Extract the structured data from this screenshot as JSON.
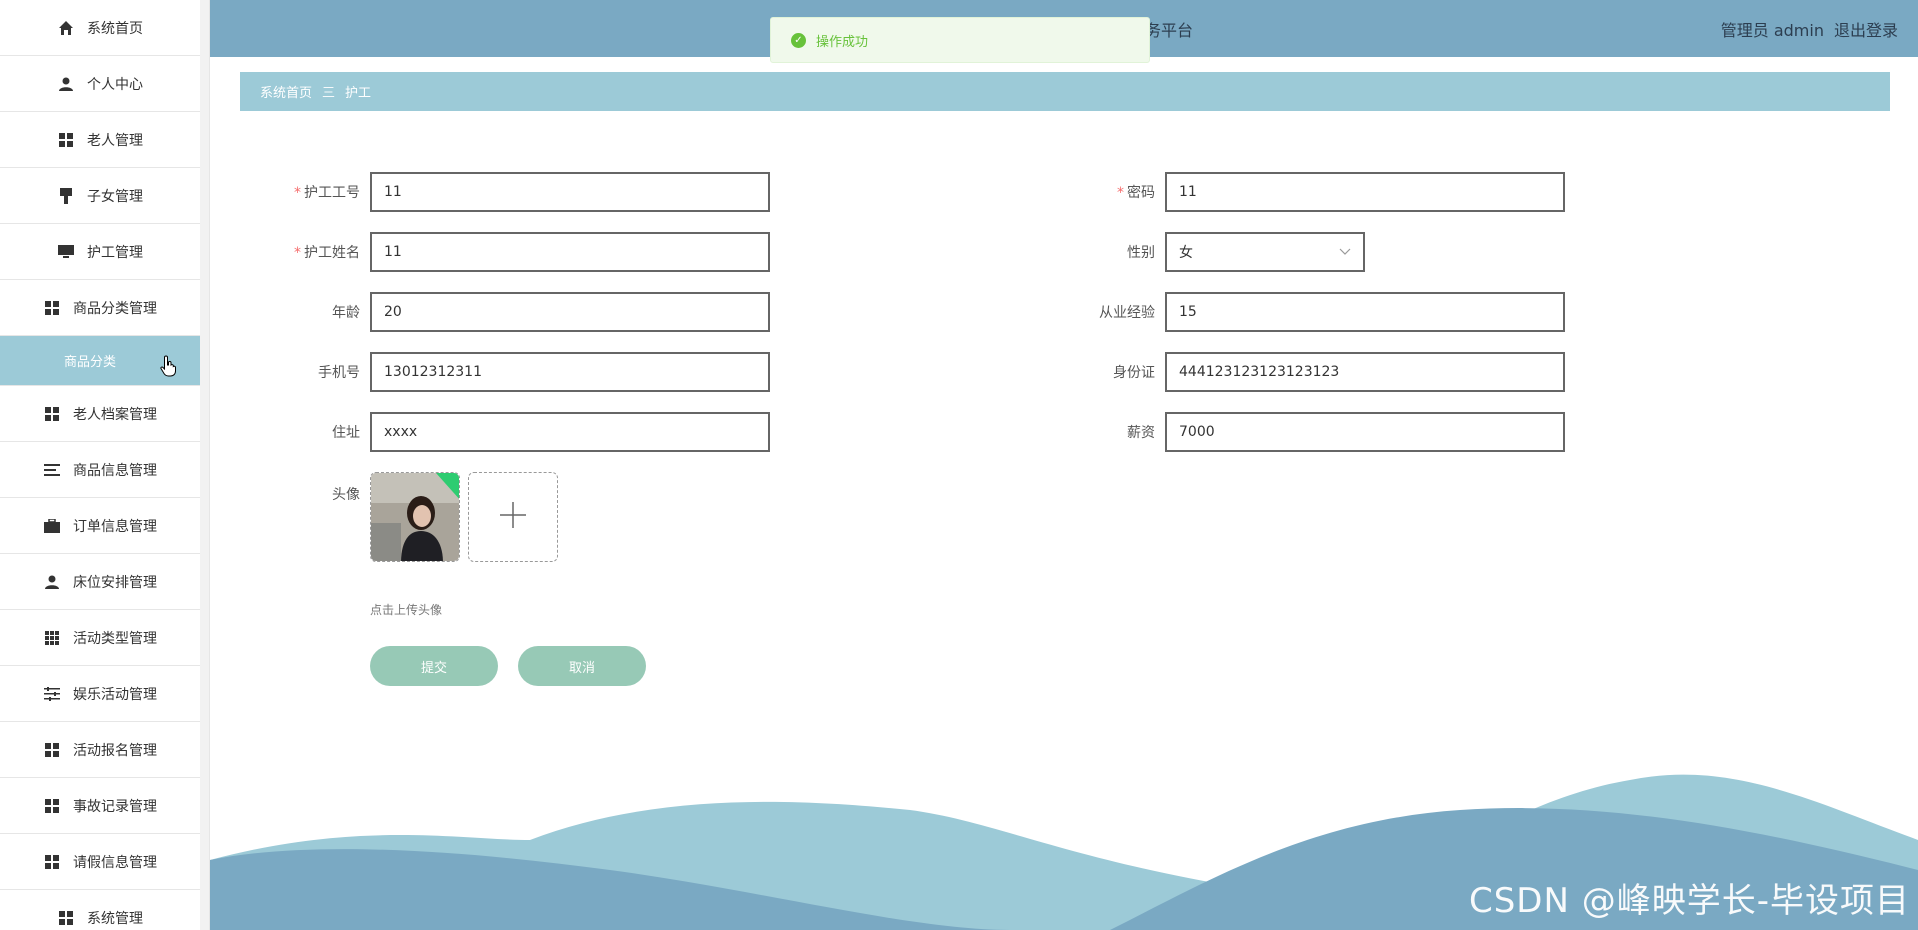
{
  "sidebar": {
    "items": [
      {
        "label": "系统首页",
        "icon": "home-icon"
      },
      {
        "label": "个人中心",
        "icon": "user-icon"
      },
      {
        "label": "老人管理",
        "icon": "grid-icon"
      },
      {
        "label": "子女管理",
        "icon": "brush-icon"
      },
      {
        "label": "护工管理",
        "icon": "monitor-icon"
      },
      {
        "label": "商品分类管理",
        "icon": "grid-icon"
      },
      {
        "label": "商品分类",
        "icon": "",
        "active": true
      },
      {
        "label": "老人档案管理",
        "icon": "grid-icon"
      },
      {
        "label": "商品信息管理",
        "icon": "list-icon"
      },
      {
        "label": "订单信息管理",
        "icon": "briefcase-icon"
      },
      {
        "label": "床位安排管理",
        "icon": "user-icon"
      },
      {
        "label": "活动类型管理",
        "icon": "apps-icon"
      },
      {
        "label": "娱乐活动管理",
        "icon": "sliders-icon"
      },
      {
        "label": "活动报名管理",
        "icon": "grid-icon"
      },
      {
        "label": "事故记录管理",
        "icon": "grid-icon"
      },
      {
        "label": "请假信息管理",
        "icon": "grid-icon"
      },
      {
        "label": "系统管理",
        "icon": "grid-icon"
      }
    ]
  },
  "header": {
    "title_fragment": "务平台",
    "user_label": "管理员 admin",
    "logout_label": "退出登录"
  },
  "toast": {
    "message": "操作成功",
    "icon": "check-circle-icon"
  },
  "breadcrumb": {
    "home": "系统首页",
    "separator": "三",
    "current": "护工"
  },
  "form": {
    "nurse_id": {
      "label": "护工工号",
      "value": "11",
      "required": true
    },
    "password": {
      "label": "密码",
      "value": "11",
      "required": true
    },
    "nurse_name": {
      "label": "护工姓名",
      "value": "11",
      "required": true
    },
    "gender": {
      "label": "性别",
      "value": "女"
    },
    "age": {
      "label": "年龄",
      "value": "20"
    },
    "experience": {
      "label": "从业经验",
      "value": "15"
    },
    "phone": {
      "label": "手机号",
      "value": "13012312311"
    },
    "id_card": {
      "label": "身份证",
      "value": "444123123123123123"
    },
    "address": {
      "label": "住址",
      "value": "xxxx"
    },
    "salary": {
      "label": "薪资",
      "value": "7000"
    },
    "avatar": {
      "label": "头像",
      "hint": "点击上传头像"
    }
  },
  "buttons": {
    "submit": "提交",
    "cancel": "取消"
  },
  "colors": {
    "header": "#7aa9c3",
    "breadcrumb": "#9ccad7",
    "button": "#97c9b6",
    "wave_light": "#9ccad7",
    "wave_dark": "#7aa9c3"
  },
  "watermark": "CSDN @峰映学长-毕设项目"
}
